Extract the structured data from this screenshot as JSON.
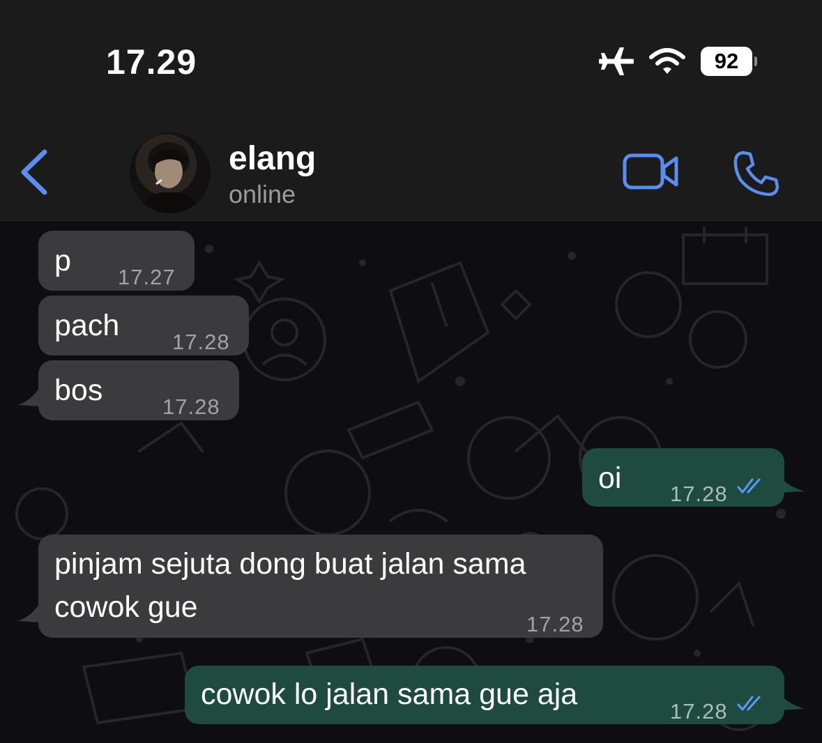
{
  "status_bar": {
    "time": "17.29",
    "battery": "92",
    "icons": [
      "airplane-icon",
      "wifi-icon",
      "battery-icon"
    ]
  },
  "header": {
    "contact_name": "elang",
    "contact_status": "online",
    "icons": [
      "back-chevron-icon",
      "avatar",
      "video-camera-icon",
      "phone-icon"
    ]
  },
  "colors": {
    "accent": "#5b8def",
    "incoming_bubble": "#3b3b3d",
    "outgoing_bubble": "#1e4a3f",
    "read_ticks": "#5b9bf5"
  },
  "messages": [
    {
      "direction": "in",
      "text": "p",
      "time": "17.27"
    },
    {
      "direction": "in",
      "text": "pach",
      "time": "17.28"
    },
    {
      "direction": "in",
      "text": "bos",
      "time": "17.28"
    },
    {
      "direction": "out",
      "text": "oi",
      "time": "17.28",
      "status": "read"
    },
    {
      "direction": "in",
      "lines": [
        "pinjam sejuta dong buat jalan sama",
        "cowok gue"
      ],
      "time": "17.28"
    },
    {
      "direction": "out",
      "text": "cowok lo jalan sama gue aja",
      "time": "17.28",
      "status": "read"
    }
  ]
}
